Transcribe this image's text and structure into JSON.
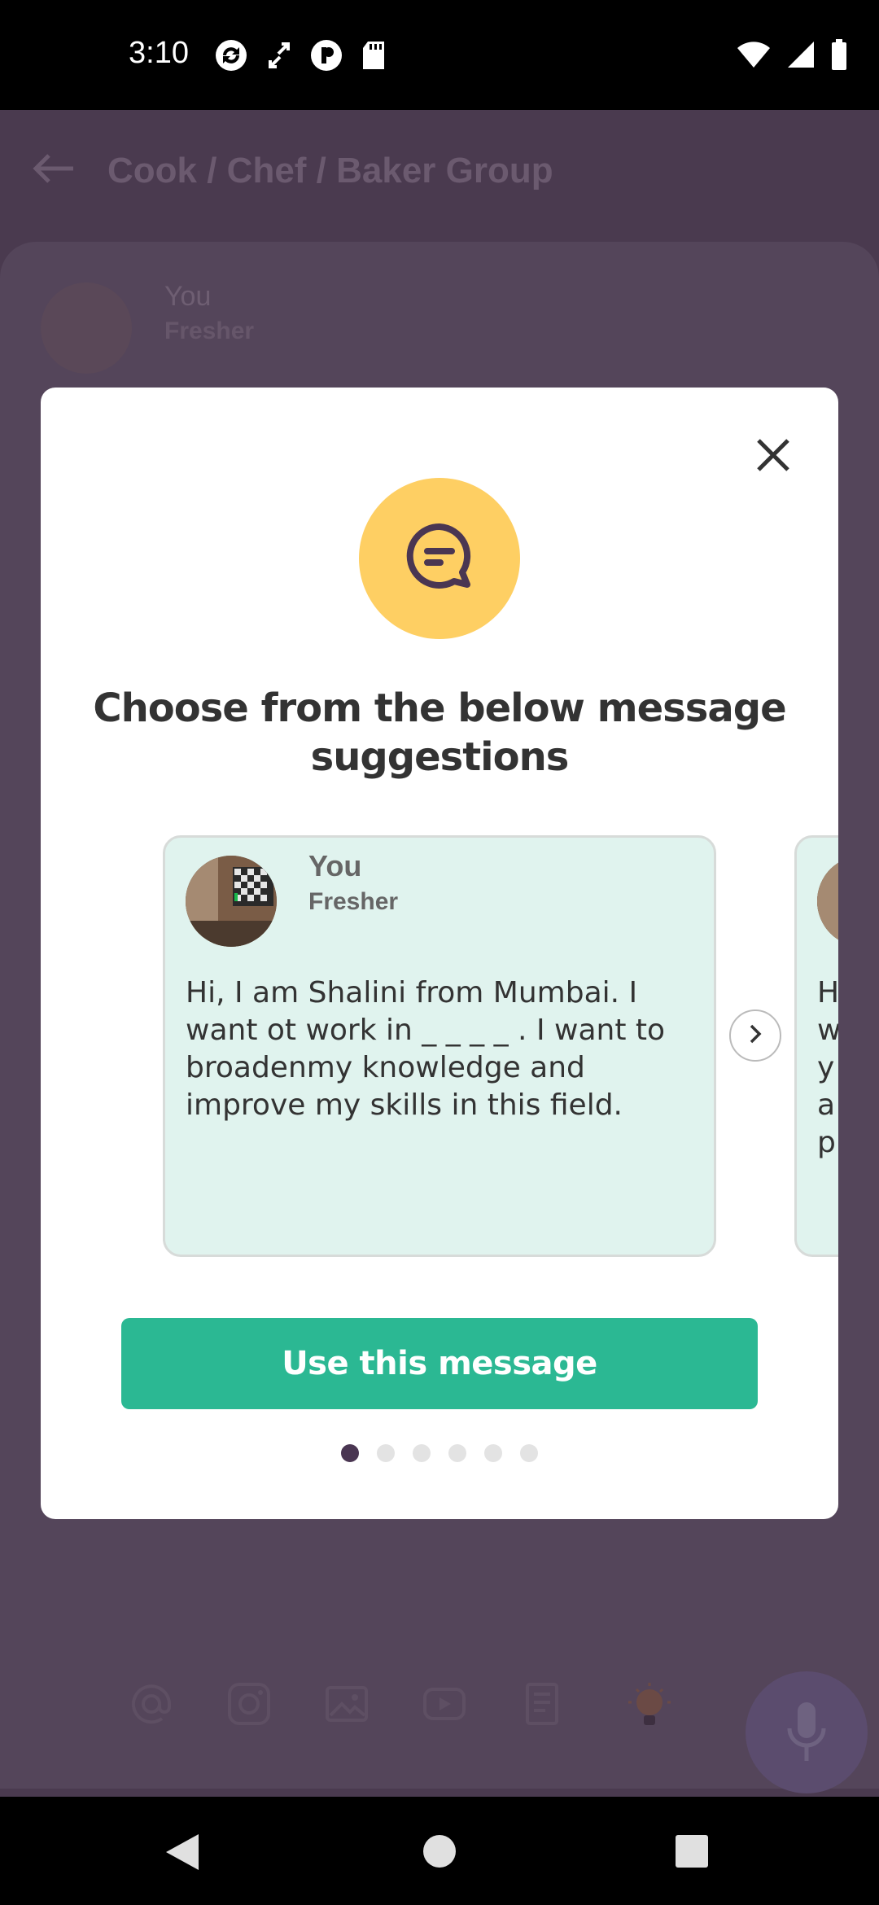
{
  "status_bar": {
    "time": "3:10",
    "left_icons": [
      "sync-icon",
      "rotate-icon",
      "pocket-icon",
      "sd-card-icon"
    ],
    "right_icons": [
      "wifi-icon",
      "signal-icon",
      "battery-icon"
    ]
  },
  "header": {
    "title": "Cook / Chef / Baker Group"
  },
  "background_post": {
    "name": "You",
    "subtitle": "Fresher"
  },
  "modal": {
    "title": "Choose from the below message suggestions",
    "cards": [
      {
        "name": "You",
        "subtitle": "Fresher",
        "message": "Hi, I am Shalini from Mumbai. I want ot work in _ _ _ _ . I want to broadenmy knowledge and improve my skills in this field."
      }
    ],
    "peek_card_text": "H\nw\ny\na\np",
    "use_button_label": "Use this message",
    "page_count": 6,
    "active_page": 1
  },
  "toolbar_icons": [
    "at-icon",
    "instagram-icon",
    "image-icon",
    "youtube-icon",
    "document-icon",
    "lightbulb-icon",
    "mic-icon"
  ],
  "colors": {
    "accent": "#2bb893",
    "icon_circle": "#fecf63",
    "card_bg": "#e0f3ee",
    "overlay_bg": "#4a3a4f"
  }
}
